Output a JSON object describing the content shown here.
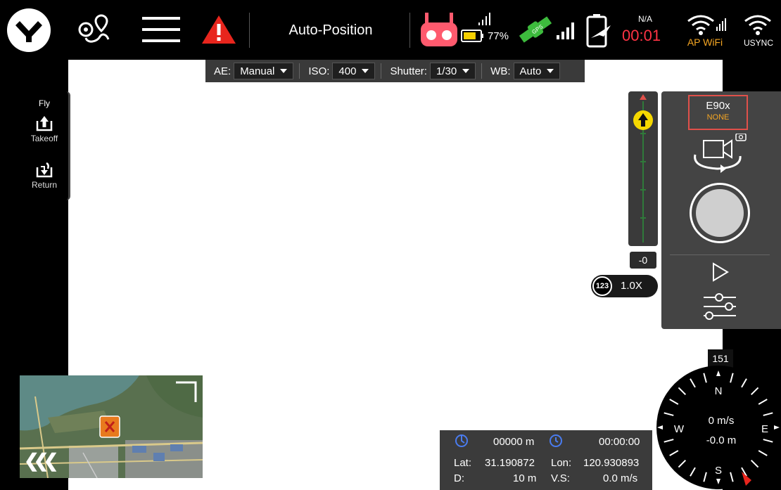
{
  "topbar": {
    "flight_mode": "Auto-Position",
    "battery_percent": "77%",
    "battery_level": 0.77,
    "signal_na": "N/A",
    "flight_time": "00:01",
    "ap_wifi_label": "AP WiFi",
    "usync_label": "USYNC",
    "colors": {
      "timer": "#ff3344",
      "rc": "#ff5a6e",
      "gps": "#3dbb3d",
      "warning": "#e8251d",
      "ap_wifi": "#f5a623"
    }
  },
  "exposure": {
    "ae_label": "AE:",
    "ae_value": "Manual",
    "iso_label": "ISO:",
    "iso_value": "400",
    "shutter_label": "Shutter:",
    "shutter_value": "1/30",
    "wb_label": "WB:",
    "wb_value": "Auto"
  },
  "fly_panel": {
    "title": "Fly",
    "takeoff_label": "Takeoff",
    "return_label": "Return"
  },
  "gimbal": {
    "pitch_value": "-0"
  },
  "zoom": {
    "badge": "123",
    "level": "1.0X"
  },
  "camera_panel": {
    "model": "E90x",
    "model_status": "NONE"
  },
  "compass": {
    "heading": "151",
    "n": "N",
    "e": "E",
    "s": "S",
    "w": "W",
    "speed": "0 m/s",
    "vertical_offset": "-0.0 m"
  },
  "telemetry": {
    "distance_home": "00000 m",
    "elapsed": "00:00:00",
    "lat_label": "Lat:",
    "lat": "31.190872",
    "lon_label": "Lon:",
    "lon": "120.930893",
    "d_label": "D:",
    "d": "10 m",
    "vs_label": "V.S:",
    "vs": "0.0 m/s"
  },
  "minimap": {
    "expand_arrows": "❮❮❮"
  }
}
